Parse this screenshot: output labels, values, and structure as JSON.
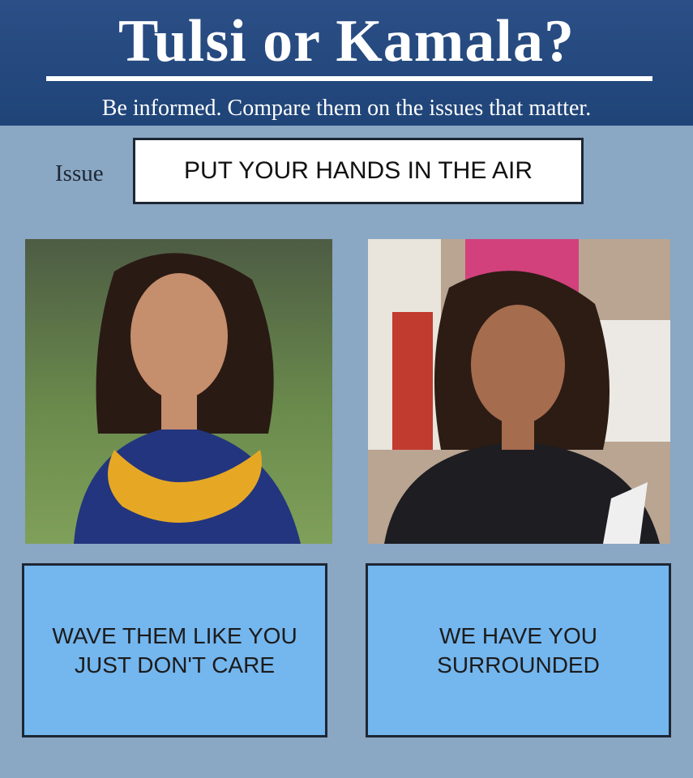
{
  "header": {
    "title": "Tulsi or Kamala?",
    "subtitle": "Be informed. Compare them on the issues that matter."
  },
  "issue": {
    "label": "Issue",
    "text": "PUT YOUR HANDS IN THE AIR"
  },
  "candidates": [
    {
      "photo_alt": "photo-left",
      "answer": "WAVE THEM LIKE YOU\nJUST DON'T CARE"
    },
    {
      "photo_alt": "photo-right",
      "answer": "WE HAVE YOU\nSURROUNDED"
    }
  ],
  "colors": {
    "background": "#8aa7c4",
    "header": "#234a80",
    "answer_box": "#74b6ee"
  }
}
